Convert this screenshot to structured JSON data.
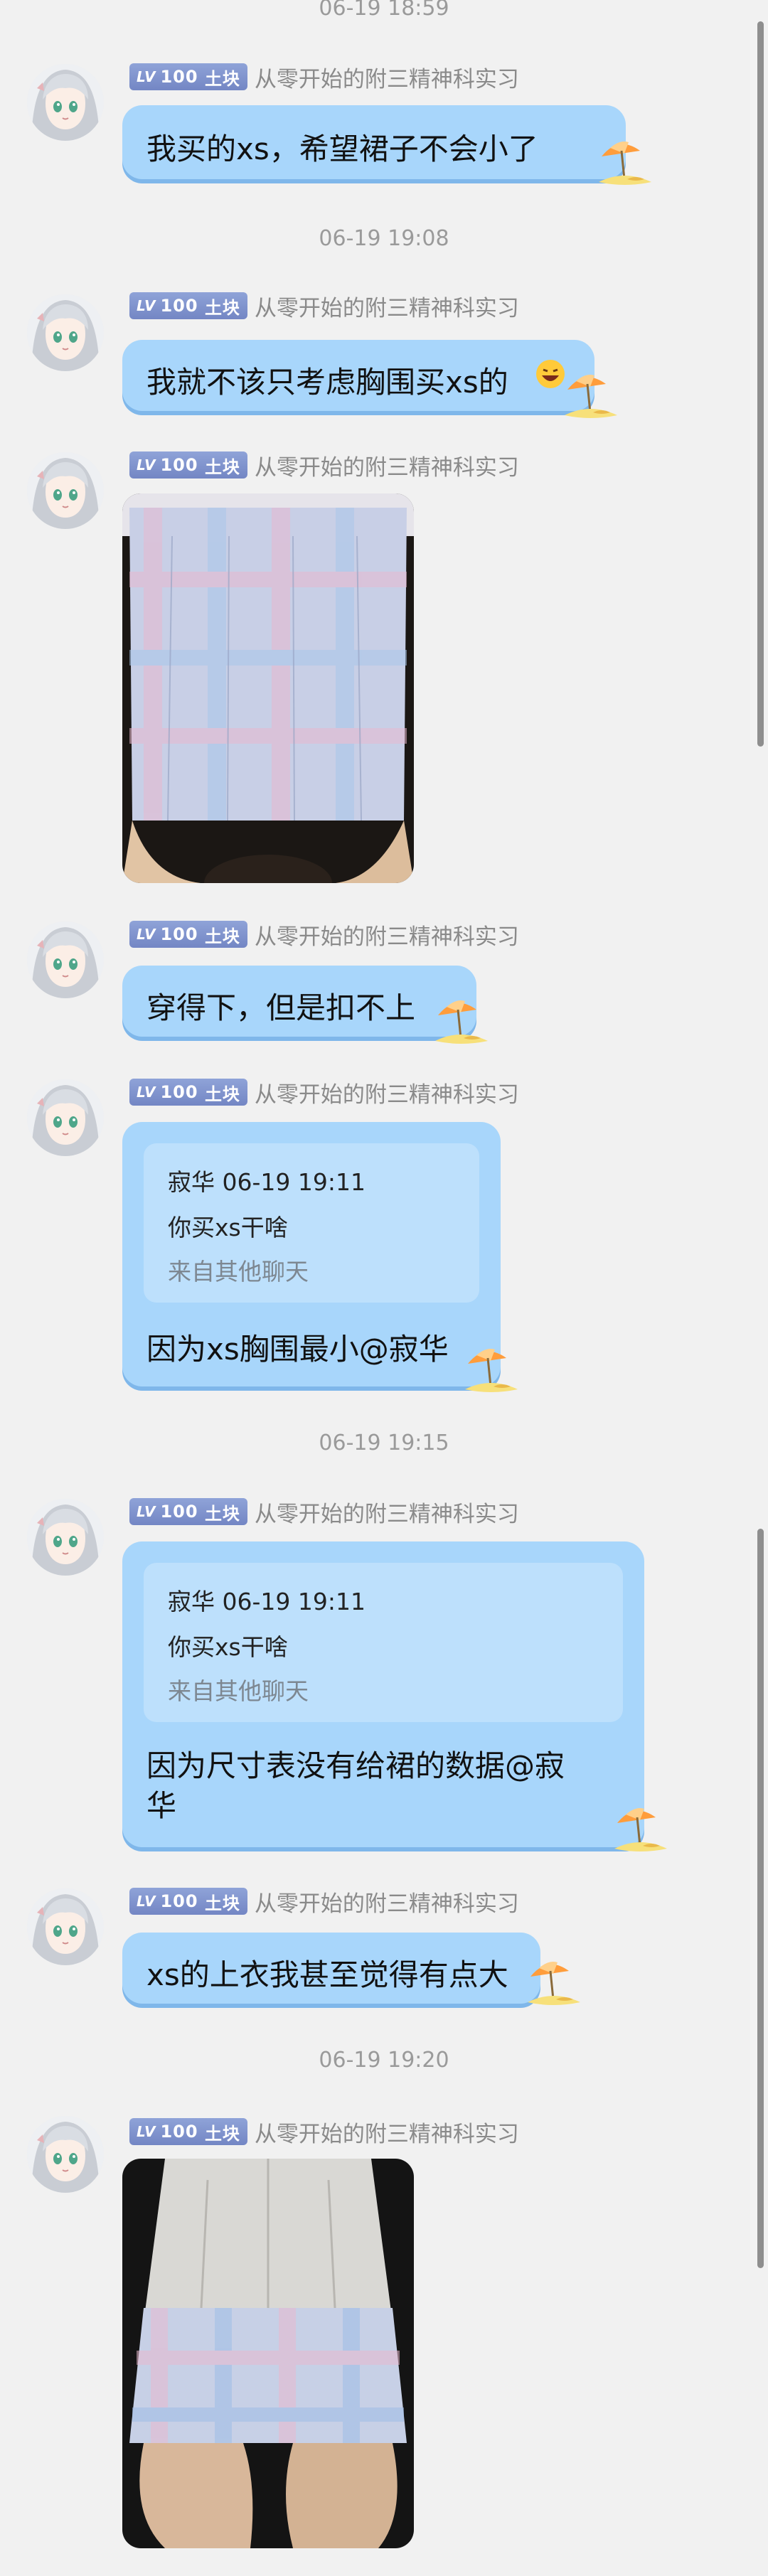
{
  "sender": {
    "level_prefix": "LV",
    "level_number": "100",
    "level_name": "土块",
    "name": "从零开始的附三精神科实习"
  },
  "messages": [
    {
      "timestamp": "06-19 18:59"
    },
    {
      "text": "我买的xs，希望裙子不会小了"
    },
    {
      "timestamp": "06-19 19:08"
    },
    {
      "text": "我就不该只考虑胸围买xs的"
    },
    {
      "image": "photo-plaid-skirt-1"
    },
    {
      "text": "穿得下，但是扣不上"
    },
    {
      "quote": {
        "header": "寂华 06-19 19:11",
        "text": "你买xs干啥",
        "source": "来自其他聊天"
      },
      "text": "因为xs胸围最小@寂华"
    },
    {
      "timestamp": "06-19 19:15"
    },
    {
      "quote": {
        "header": "寂华 06-19 19:11",
        "text": "你买xs干啥",
        "source": "来自其他聊天"
      },
      "text_line1": "因为尺寸表没有给裙的数据@寂",
      "text_line2": "华"
    },
    {
      "text": "xs的上衣我甚至觉得有点大"
    },
    {
      "timestamp": "06-19 19:20"
    },
    {
      "image": "photo-plaid-skirt-2"
    }
  ]
}
